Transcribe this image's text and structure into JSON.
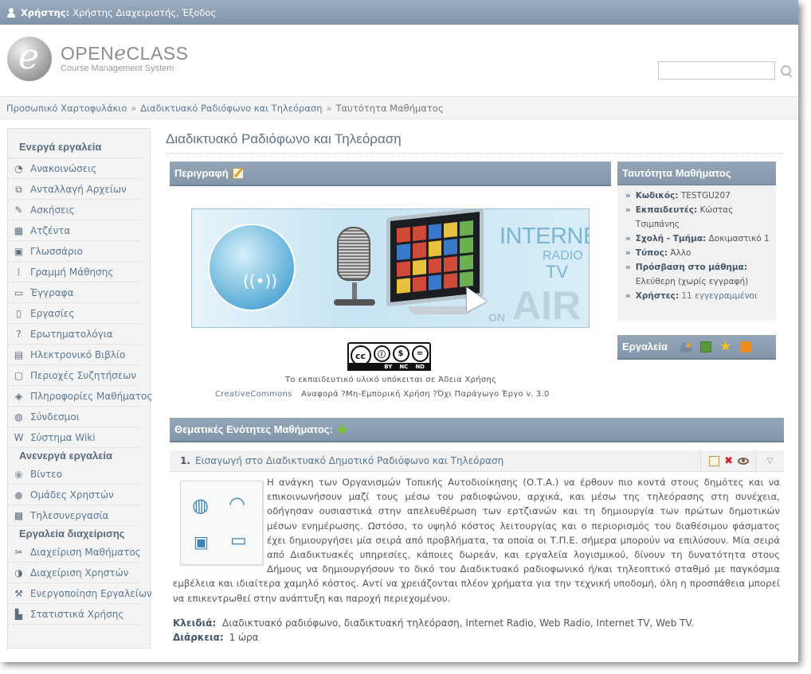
{
  "topbar": {
    "user_label": "Χρήστης:",
    "user_name": "Χρήστης Διαχειριστής,",
    "logout": "Έξοδος"
  },
  "logo": {
    "letter": "e",
    "main_left": "OPEN",
    "main_mid": "e",
    "main_right": "CLASS",
    "sub": "Course Management System"
  },
  "search": {
    "value": "",
    "placeholder": ""
  },
  "breadcrumb": {
    "items": [
      "Προσωπικό Χαρτοφυλάκιο",
      "Διαδικτυακό Ραδιόφωνο και Τηλεόραση",
      "Ταυτότητα Μαθήματος"
    ],
    "separator": "»"
  },
  "sidebar": {
    "active_heading": "Ενεργά εργαλεία",
    "active_items": [
      {
        "label": "Ανακοινώσεις",
        "icon": "announcements-icon"
      },
      {
        "label": "Ανταλλαγή Αρχείων",
        "icon": "file-exchange-icon"
      },
      {
        "label": "Ασκήσεις",
        "icon": "exercises-icon"
      },
      {
        "label": "Ατζέντα",
        "icon": "agenda-icon"
      },
      {
        "label": "Γλωσσάριο",
        "icon": "glossary-icon"
      },
      {
        "label": "Γραμμή Μάθησης",
        "icon": "learning-path-icon"
      },
      {
        "label": "Έγγραφα",
        "icon": "documents-icon"
      },
      {
        "label": "Εργασίες",
        "icon": "assignments-icon"
      },
      {
        "label": "Ερωτηματολόγια",
        "icon": "questionnaires-icon"
      },
      {
        "label": "Ηλεκτρονικό Βιβλίο",
        "icon": "ebook-icon"
      },
      {
        "label": "Περιοχές Συζητήσεων",
        "icon": "forums-icon"
      },
      {
        "label": "Πληροφορίες Μαθήματος",
        "icon": "course-info-icon"
      },
      {
        "label": "Σύνδεσμοι",
        "icon": "links-icon"
      },
      {
        "label": "Σύστημα Wiki",
        "icon": "wiki-icon"
      }
    ],
    "inactive_heading": "Ανενεργά εργαλεία",
    "inactive_items": [
      {
        "label": "Βίντεο",
        "icon": "video-icon"
      },
      {
        "label": "Ομάδες Χρηστών",
        "icon": "user-groups-icon"
      },
      {
        "label": "Τηλεσυνεργασία",
        "icon": "teleconference-icon"
      }
    ],
    "admin_heading": "Εργαλεία διαχείρισης",
    "admin_items": [
      {
        "label": "Διαχείριση Μαθήματος",
        "icon": "course-admin-icon"
      },
      {
        "label": "Διαχείριση Χρηστών",
        "icon": "user-admin-icon"
      },
      {
        "label": "Ενεργοποίηση Εργαλείων",
        "icon": "tool-activation-icon"
      },
      {
        "label": "Στατιστικά Χρήσης",
        "icon": "usage-stats-icon"
      }
    ]
  },
  "main": {
    "title": "Διαδικτυακό Ραδιόφωνο και Τηλεόραση",
    "description_heading": "Περιγραφή",
    "banner": {
      "internet": "INTERNET",
      "radio": "RADIO",
      "tv": "TV",
      "on": "ON",
      "air": "AIR"
    },
    "license": {
      "badges": [
        "cc",
        "BY",
        "NC",
        "ND"
      ],
      "badge_labels": [
        "BY",
        "NC",
        "ND"
      ],
      "text": "Το εκπαιδευτικό υλικό υπόκειται σε Άδεια Χρήσης",
      "link": "CreativeCommons",
      "detail": "Αναφορά ?Μη-Εμπορική Χρήση ?Όχι Παράγωγο Έργο v. 3.0"
    },
    "units_heading": "Θεματικές Ενότητες Μαθήματος:",
    "unit": {
      "number": "1.",
      "title": "Εισαγωγή στο Διαδικτυακό Δημοτικό Ραδιόφωνο και Τηλεόραση",
      "text": "Η ανάγκη των Οργανισμών Τοπικής Αυτοδιοίκησης (Ο.Τ.Α.) να έρθουν πιο κοντά στους δημότες και να επικοινωνήσουν μαζί τους μέσω του ραδιοφώνου, αρχικά, και μέσω της τηλεόρασης στη συνέχεια, οδήγησαν ουσιαστικά στην απελευθέρωση των ερτζιανών και τη δημιουργία των πρώτων δημοτικών μέσων ενημέρωσης. Ωστόσο, το υψηλό κόστος λειτουργίας και ο περιορισμός του διαθέσιμου φάσματος έχει δημιουργήσει μία σειρά από προβλήματα, τα οποία οι Τ.Π.Ε. σήμερα μπορούν να επιλύσουν. Μία σειρά από Διαδικτυακές υπηρεσίες, κάποιες δωρεάν, και εργαλεία λογισμικού, δίνουν τη δυνατότητα στους Δήμους να δημιουργήσουν το δικό του Διαδικτυακό ραδιοφωνικό ή/και τηλεοπτικό σταθμό με παγκόσμια εμβέλεια και ιδιαίτερα χαμηλό κόστος. Αντί να χρειάζονται πλέον χρήματα για την τεχνική υποδομή, όλη η προσπάθεια μπορεί να επικεντρωθεί στην ανάπτυξη και παροχή περιεχομένου.",
      "keywords_label": "Κλειδιά:",
      "keywords": "Διαδικτυακό ραδιόφωνο, διαδικτυακή τηλεόραση, Internet Radio, Web Radio, Internet TV, Web TV.",
      "duration_label": "Διάρκεια:",
      "duration": "1 ώρα"
    }
  },
  "identity": {
    "heading": "Ταυτότητα Μαθήματος",
    "bullet": "»",
    "code_label": "Κωδικός:",
    "code": "TESTGU207",
    "instructors_label": "Εκπαιδευτές:",
    "instructors": "Κώστας Τσιμπάνης",
    "school_label": "Σχολή - Τμήμα:",
    "school": "Δοκιμαστικό 1",
    "type_label": "Τύπος:",
    "type": "Άλλο",
    "access_label": "Πρόσβαση στο μάθημα:",
    "access": "Ελεύθερη (χωρίς εγγραφή)",
    "users_label": "Χρήστες:",
    "users": "11 εγγεγραμμένοι"
  },
  "tools_box": {
    "heading": "Εργαλεία",
    "icons": [
      "users-icon",
      "mail-icon",
      "star-icon",
      "rss-icon"
    ]
  },
  "colors": {
    "topbar": "#8a9cb0",
    "panel_header": "#8a9bae",
    "link": "#5b7894",
    "heading": "#5a6b7c",
    "add": "#7cbf3c",
    "delete": "#d42020"
  }
}
